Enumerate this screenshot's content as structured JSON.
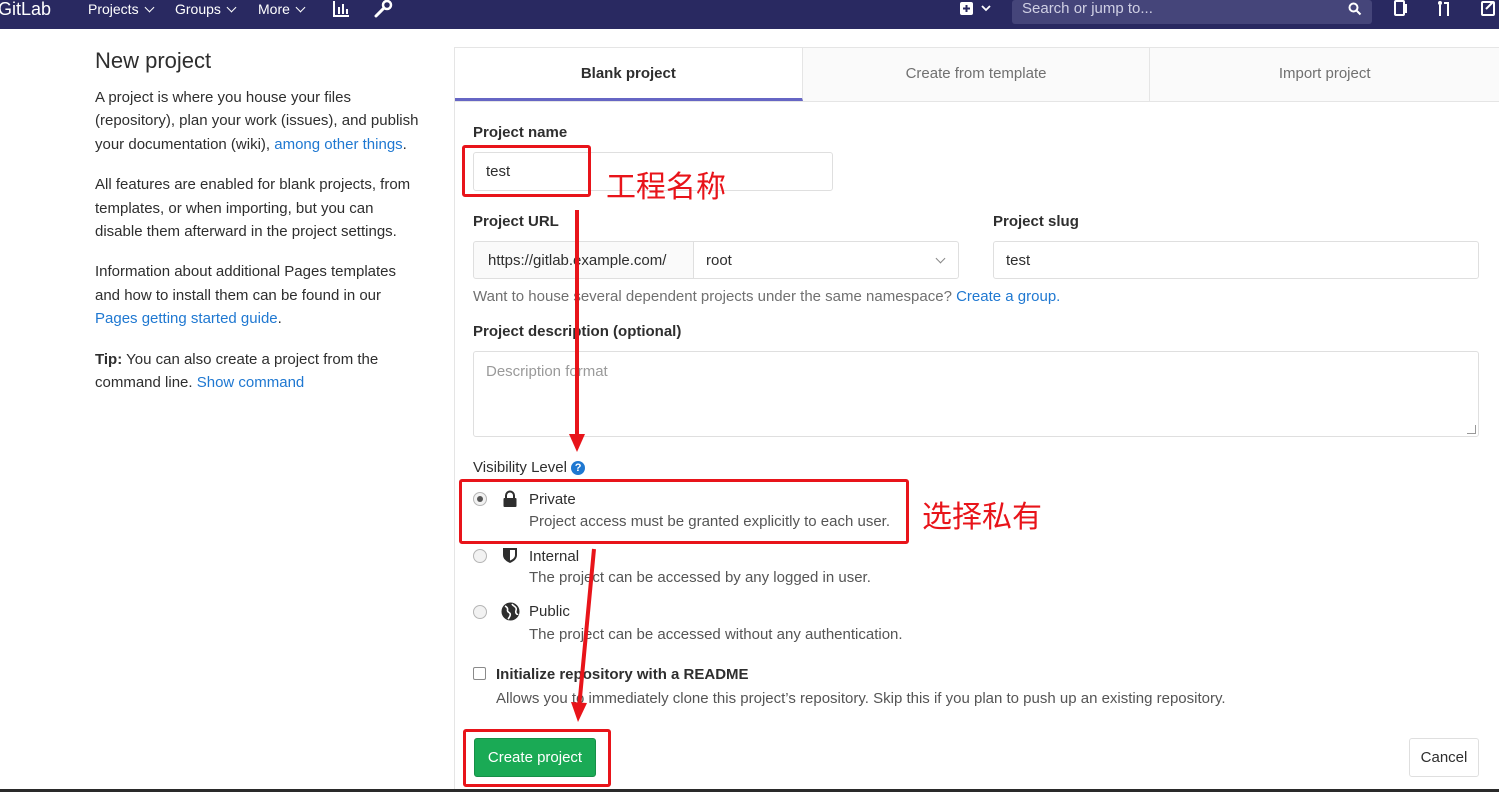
{
  "navbar": {
    "logo": "GitLab",
    "items": [
      {
        "label": "Projects"
      },
      {
        "label": "Groups"
      },
      {
        "label": "More"
      }
    ],
    "search_placeholder": "Search or jump to...",
    "icons": [
      "chart-icon",
      "wrench-icon",
      "plus-square-icon",
      "todo-icon",
      "merge-request-icon",
      "issues-icon"
    ]
  },
  "sidebar": {
    "title": "New project",
    "para1_text": "A project is where you house your files (repository), plan your work (issues), and publish your documentation (wiki),",
    "para1_link": "among other things",
    "para1_end": ".",
    "para2": "All features are enabled for blank projects, from templates, or when importing, but you can disable them afterward in the project settings.",
    "para3_text": "Information about additional Pages templates and how to install them can be found in our",
    "para3_link": "Pages getting started guide",
    "para3_end": ".",
    "tip_label": "Tip:",
    "tip_text": "You can also create a project from the command line.",
    "tip_link": "Show command"
  },
  "tabs": [
    {
      "label": "Blank project",
      "active": true
    },
    {
      "label": "Create from template",
      "active": false
    },
    {
      "label": "Import project",
      "active": false
    }
  ],
  "form": {
    "project_name_label": "Project name",
    "project_name_value": "test",
    "project_url_label": "Project URL",
    "url_prefix": "https://gitlab.example.com/",
    "namespace_value": "root",
    "project_slug_label": "Project slug",
    "project_slug_value": "test",
    "namespace_help": "Want to house several dependent projects under the same namespace?",
    "namespace_help_link": "Create a group.",
    "description_label": "Project description (optional)",
    "description_placeholder": "Description format",
    "visibility_label": "Visibility Level",
    "visibility_options": [
      {
        "title": "Private",
        "desc": "Project access must be granted explicitly to each user.",
        "checked": true,
        "icon": "lock-icon"
      },
      {
        "title": "Internal",
        "desc": "The project can be accessed by any logged in user.",
        "checked": false,
        "icon": "shield-icon"
      },
      {
        "title": "Public",
        "desc": "The project can be accessed without any authentication.",
        "checked": false,
        "icon": "globe-icon"
      }
    ],
    "readme_label": "Initialize repository with a README",
    "readme_desc": "Allows you to immediately clone this project’s repository. Skip this if you plan to push up an existing repository.",
    "create_button": "Create project",
    "cancel_button": "Cancel"
  },
  "annotations": {
    "name_note": "工程名称",
    "private_note": "选择私有",
    "color": "#e8141a"
  },
  "colors": {
    "navbar": "#292961",
    "primary_green": "#1aaa55",
    "link_blue": "#1f78d1",
    "active_tab_underline": "#6666c4"
  }
}
